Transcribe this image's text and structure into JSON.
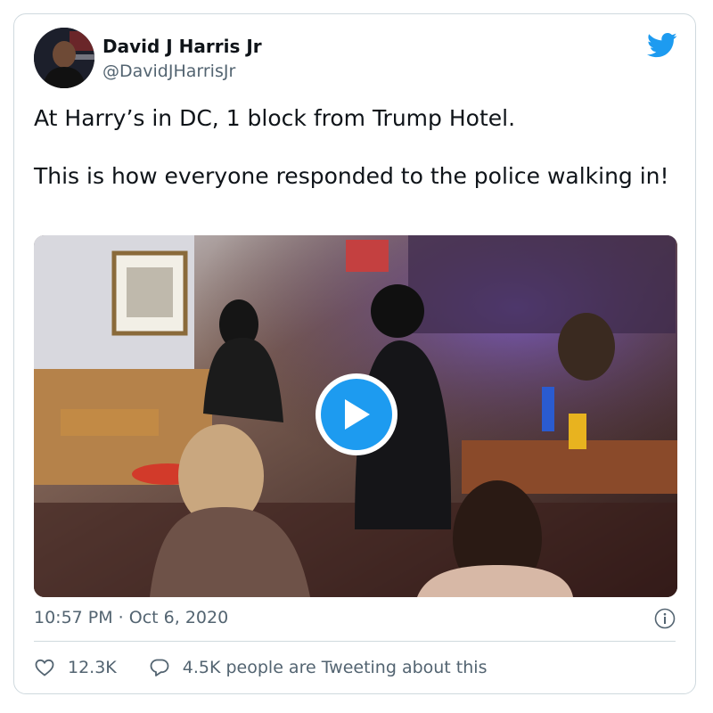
{
  "author": {
    "display_name": "David J Harris Jr",
    "handle": "@DavidJHarrisJr",
    "avatar_icon": "profile-photo"
  },
  "brand": {
    "icon": "twitter-bird-icon",
    "color": "#1d9bf0"
  },
  "tweet": {
    "line1": "At Harry’s in DC, 1 block from Trump Hotel.",
    "line2": "This is how everyone responded to the police walking in!"
  },
  "media": {
    "type": "video",
    "play_icon": "play-icon",
    "accent": "#1d9bf0"
  },
  "meta": {
    "timestamp": "10:57 PM · Oct 6, 2020",
    "info_icon": "info-icon"
  },
  "actions": {
    "likes": "12.3K",
    "replies_text": "4.5K people are Tweeting about this"
  },
  "colors": {
    "text": "#0f1419",
    "secondary": "#536471",
    "border": "#cfd9de"
  }
}
